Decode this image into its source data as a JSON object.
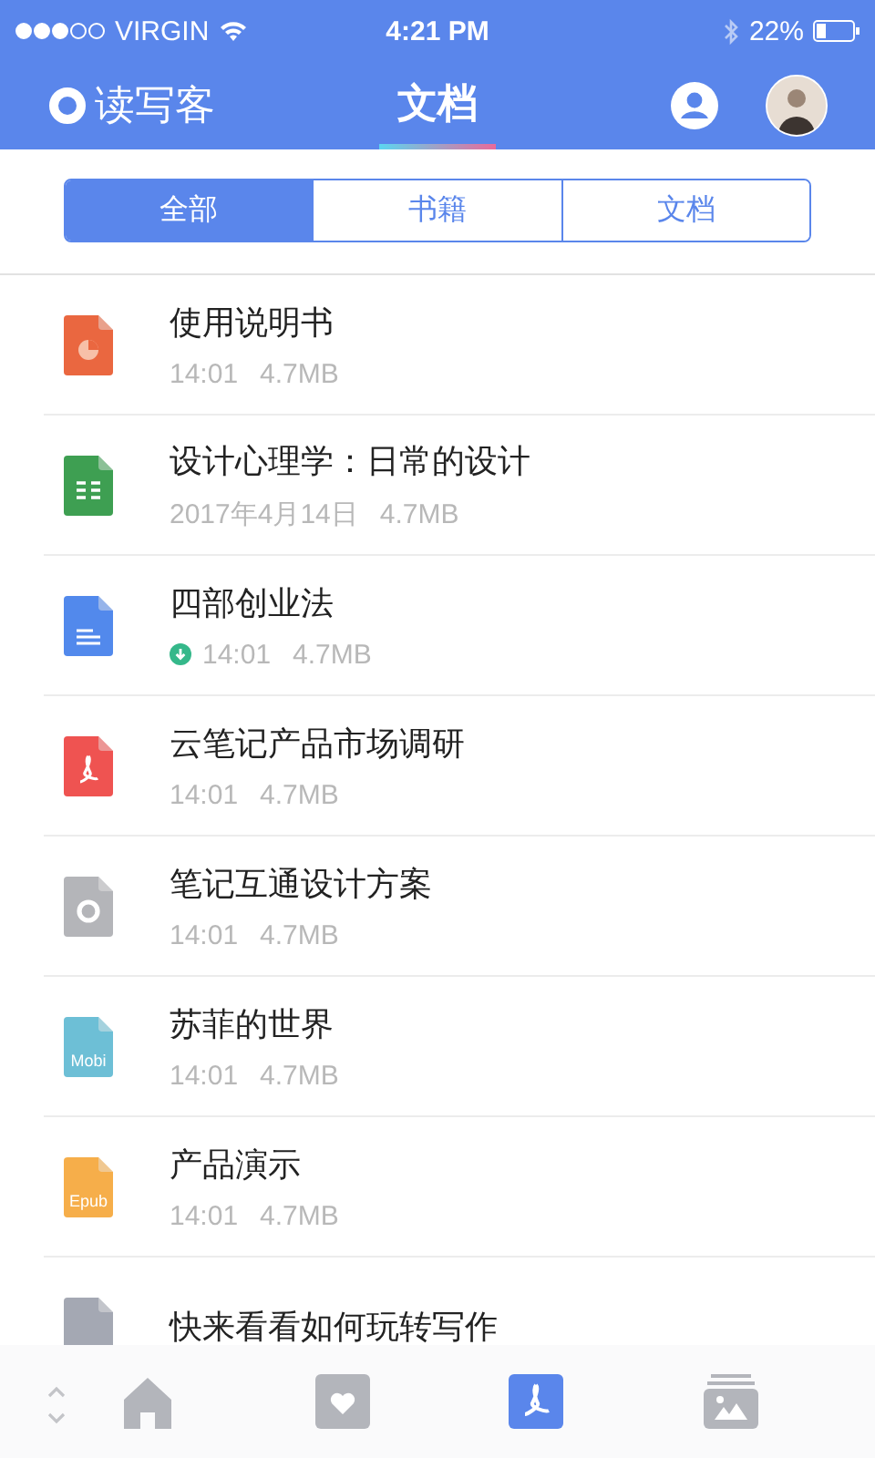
{
  "status_bar": {
    "carrier": "VIRGIN",
    "time": "4:21 PM",
    "battery": "22%"
  },
  "nav": {
    "logo": "读写客",
    "title": "文档"
  },
  "segments": [
    {
      "label": "全部",
      "selected": true
    },
    {
      "label": "书籍",
      "selected": false
    },
    {
      "label": "文档",
      "selected": false
    }
  ],
  "files": [
    {
      "kind": "ppt",
      "title": "使用说明书",
      "date": "14:01",
      "size": "4.7MB",
      "downloaded": false
    },
    {
      "kind": "sheet",
      "title": "设计心理学：日常的设计",
      "date": "2017年4月14日",
      "size": "4.7MB",
      "downloaded": false
    },
    {
      "kind": "doc",
      "title": "四部创业法",
      "date": "14:01",
      "size": "4.7MB",
      "downloaded": true
    },
    {
      "kind": "pdf",
      "title": "云笔记产品市场调研",
      "date": "14:01",
      "size": "4.7MB",
      "downloaded": false
    },
    {
      "kind": "image",
      "title": "笔记互通设计方案",
      "date": "14:01",
      "size": "4.7MB",
      "downloaded": false
    },
    {
      "kind": "mobi",
      "badge": "Mobi",
      "title": "苏菲的世界",
      "date": "14:01",
      "size": "4.7MB",
      "downloaded": false
    },
    {
      "kind": "epub",
      "badge": "Epub",
      "title": "产品演示",
      "date": "14:01",
      "size": "4.7MB",
      "downloaded": false
    },
    {
      "kind": "txt",
      "title": "快来看看如何玩转写作",
      "downloaded": false
    }
  ],
  "tab_bar": [
    {
      "kind": "home",
      "selected": false
    },
    {
      "kind": "favorites",
      "selected": false
    },
    {
      "kind": "documents",
      "selected": true
    },
    {
      "kind": "gallery",
      "selected": false
    }
  ]
}
